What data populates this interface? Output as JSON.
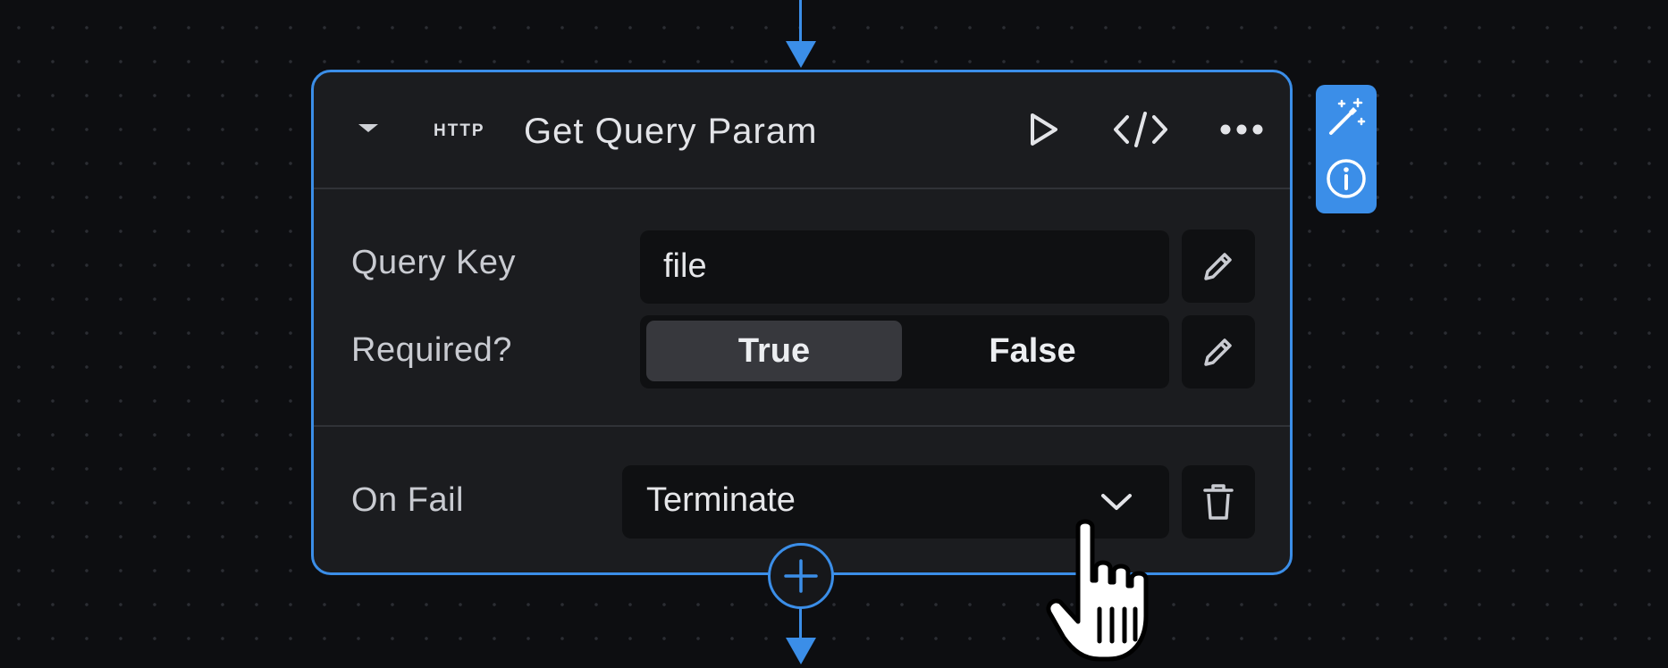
{
  "node": {
    "type_badge": "HTTP",
    "title": "Get Query Param",
    "actions": {
      "collapse_icon": "caret-down-icon",
      "run_icon": "play-icon",
      "code_icon": "code-icon",
      "more_icon": "more-horizontal-icon"
    },
    "fields": {
      "query_key": {
        "label": "Query Key",
        "value": "file"
      },
      "required": {
        "label": "Required?",
        "options": [
          "True",
          "False"
        ],
        "selected": "True"
      },
      "on_fail": {
        "label": "On Fail",
        "value": "Terminate"
      }
    }
  },
  "side_panel": {
    "icons": [
      "magic-wand-icon",
      "info-icon"
    ]
  },
  "colors": {
    "accent": "#3b8ee8",
    "canvas": "#0d0e11",
    "node_bg": "#1b1c1f",
    "field_bg": "#0f1012",
    "selected_segment": "#37383d"
  }
}
